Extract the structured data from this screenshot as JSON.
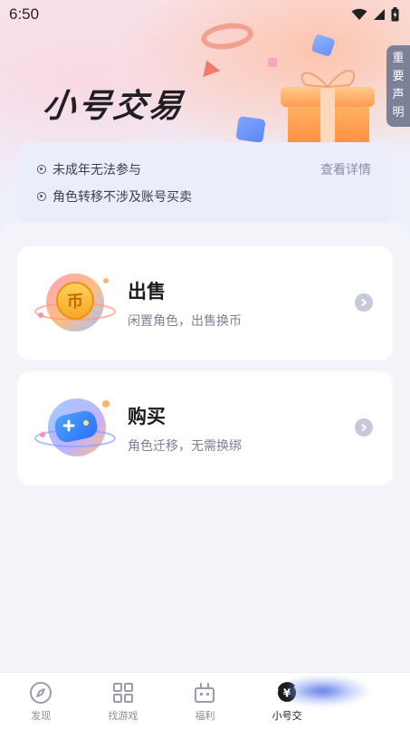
{
  "status_bar": {
    "time": "6:50"
  },
  "banner": {
    "title": "小号交易",
    "side_button": [
      "重",
      "要",
      "声",
      "明"
    ]
  },
  "notice": {
    "items": [
      "未成年无法参与",
      "角色转移不涉及账号买卖"
    ],
    "link": "查看详情"
  },
  "cards": [
    {
      "title": "出售",
      "subtitle": "闲置角色，出售换币",
      "icon": "coin-icon"
    },
    {
      "title": "购买",
      "subtitle": "角色迁移，无需换绑",
      "icon": "gamepad-icon"
    }
  ],
  "bottom_nav": {
    "items": [
      {
        "label": "发现",
        "icon": "compass-icon"
      },
      {
        "label": "找游戏",
        "icon": "grid-icon"
      },
      {
        "label": "福利",
        "icon": "gift-robot-icon"
      },
      {
        "label": "小号交",
        "icon": "yuan-exchange-icon"
      }
    ],
    "active_index": 3
  },
  "colors": {
    "background": "#f5f6fa",
    "notice_bg": "#ebedfb",
    "side_button_bg": "#7c8099",
    "card_bg": "#ffffff"
  }
}
